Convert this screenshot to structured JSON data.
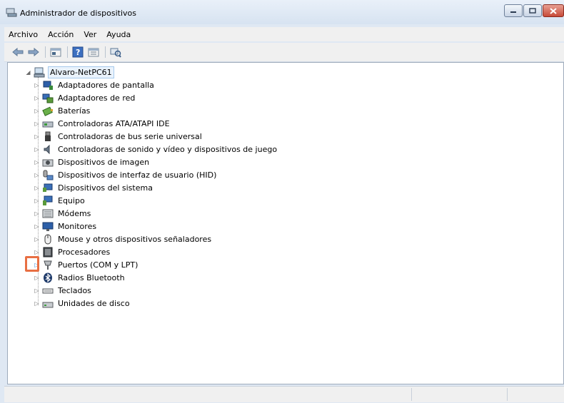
{
  "window": {
    "title": "Administrador de dispositivos"
  },
  "menu": {
    "items": [
      "Archivo",
      "Acción",
      "Ver",
      "Ayuda"
    ]
  },
  "toolbar": {
    "buttons": [
      "back-icon",
      "forward-icon",
      "properties-icon",
      "help-icon",
      "view-icon",
      "scan-hardware-icon"
    ]
  },
  "tree": {
    "root": "Alvaro-NetPC61",
    "items": [
      {
        "label": "Adaptadores de pantalla",
        "icon": "display-adapter-icon"
      },
      {
        "label": "Adaptadores de red",
        "icon": "network-adapter-icon"
      },
      {
        "label": "Baterías",
        "icon": "battery-icon"
      },
      {
        "label": "Controladoras ATA/ATAPI IDE",
        "icon": "ide-controller-icon"
      },
      {
        "label": "Controladoras de bus serie universal",
        "icon": "usb-icon"
      },
      {
        "label": "Controladoras de sonido y vídeo y dispositivos de juego",
        "icon": "sound-icon"
      },
      {
        "label": "Dispositivos de imagen",
        "icon": "imaging-icon"
      },
      {
        "label": "Dispositivos de interfaz de usuario (HID)",
        "icon": "hid-icon"
      },
      {
        "label": "Dispositivos del sistema",
        "icon": "system-devices-icon"
      },
      {
        "label": "Equipo",
        "icon": "computer-icon"
      },
      {
        "label": "Módems",
        "icon": "modem-icon"
      },
      {
        "label": "Monitores",
        "icon": "monitor-icon"
      },
      {
        "label": "Mouse y otros dispositivos señaladores",
        "icon": "mouse-icon"
      },
      {
        "label": "Procesadores",
        "icon": "processor-icon"
      },
      {
        "label": "Puertos (COM y LPT)",
        "icon": "port-icon"
      },
      {
        "label": "Radios Bluetooth",
        "icon": "bluetooth-icon"
      },
      {
        "label": "Teclados",
        "icon": "keyboard-icon"
      },
      {
        "label": "Unidades de disco",
        "icon": "disk-drive-icon"
      }
    ]
  },
  "colors": {
    "highlight_border": "#e86f43",
    "root_selection": "#a6c9ec"
  }
}
